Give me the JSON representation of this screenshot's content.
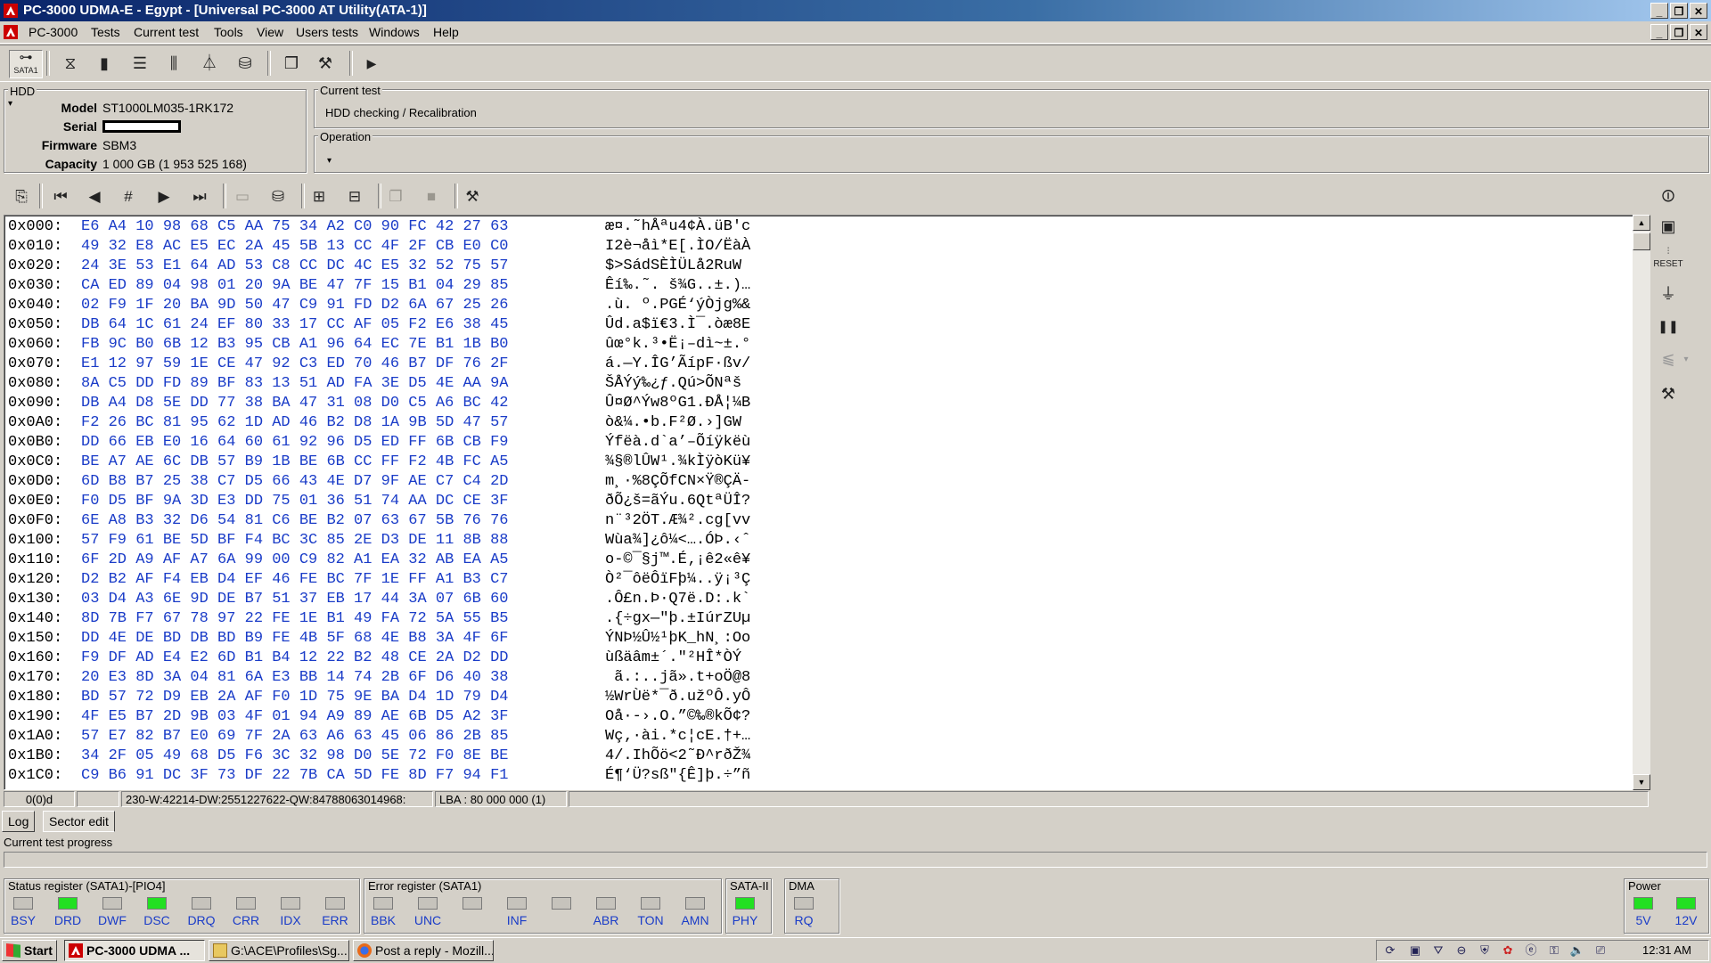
{
  "window": {
    "title": "PC-3000 UDMA-E - Egypt - [Universal PC-3000 AT Utility(ATA-1)]",
    "caption_buttons": [
      "_",
      "❐",
      "✕"
    ],
    "mdi_buttons": [
      "_",
      "❐",
      "✕"
    ]
  },
  "menu": [
    "PC-3000",
    "Tests",
    "Current test",
    "Tools",
    "View",
    "Users tests",
    "Windows",
    "Help"
  ],
  "toolbar": {
    "sata_label": "SATA1",
    "icons": [
      "hdd-icon",
      "chip-icon",
      "list-icon",
      "chart-icon",
      "tree-icon",
      "disk-icon",
      "windows-icon",
      "tools-icon",
      "play-icon"
    ]
  },
  "hdd": {
    "title": "HDD",
    "model_label": "Model",
    "model": "ST1000LM035-1RK172",
    "serial_label": "Serial",
    "firmware_label": "Firmware",
    "firmware": "SBM3",
    "capacity_label": "Capacity",
    "capacity": "1 000 GB (1 953 525 168)"
  },
  "current_test": {
    "title": "Current test",
    "value": "HDD checking / Recalibration"
  },
  "operation": {
    "title": "Operation",
    "value": ""
  },
  "hex_rows": [
    {
      "addr": "0x000:",
      "bytes": "E6 A4 10 98 68 C5 AA 75 34 A2 C0 90 FC 42 27 63",
      "ascii": "æ¤.˜hÅªu4¢À.üB'c"
    },
    {
      "addr": "0x010:",
      "bytes": "49 32 E8 AC E5 EC 2A 45 5B 13 CC 4F 2F CB E0 C0",
      "ascii": "I2è¬åì*E[.ÌO/ËàÀ"
    },
    {
      "addr": "0x020:",
      "bytes": "24 3E 53 E1 64 AD 53 C8 CC DC 4C E5 32 52 75 57",
      "ascii": "$>SádSÈÌÜLå2RuW"
    },
    {
      "addr": "0x030:",
      "bytes": "CA ED 89 04 98 01 20 9A BE 47 7F 15 B1 04 29 85",
      "ascii": "Êí‰.˜. š¾G..±.)…"
    },
    {
      "addr": "0x040:",
      "bytes": "02 F9 1F 20 BA 9D 50 47 C9 91 FD D2 6A 67 25 26",
      "ascii": ".ù. º.PGÉ‘ýÒjg%&"
    },
    {
      "addr": "0x050:",
      "bytes": "DB 64 1C 61 24 EF 80 33 17 CC AF 05 F2 E6 38 45",
      "ascii": "Ûd.a$ï€3.Ì¯.òæ8E"
    },
    {
      "addr": "0x060:",
      "bytes": "FB 9C B0 6B 12 B3 95 CB A1 96 64 EC 7E B1 1B B0",
      "ascii": "ûœ°k.³•Ë¡–dì~±.°"
    },
    {
      "addr": "0x070:",
      "bytes": "E1 12 97 59 1E CE 47 92 C3 ED 70 46 B7 DF 76 2F",
      "ascii": "á.—Y.ÎG’ÃípF·ßv/"
    },
    {
      "addr": "0x080:",
      "bytes": "8A C5 DD FD 89 BF 83 13 51 AD FA 3E D5 4E AA 9A",
      "ascii": "ŠÅÝý‰¿ƒ.Qú>ÕNªš"
    },
    {
      "addr": "0x090:",
      "bytes": "DB A4 D8 5E DD 77 38 BA 47 31 08 D0 C5 A6 BC 42",
      "ascii": "Û¤Ø^Ýw8ºG1.ÐÅ¦¼B"
    },
    {
      "addr": "0x0A0:",
      "bytes": "F2 26 BC 81 95 62 1D AD 46 B2 D8 1A 9B 5D 47 57",
      "ascii": "ò&¼.•b.F²Ø.›]GW"
    },
    {
      "addr": "0x0B0:",
      "bytes": "DD 66 EB E0 16 64 60 61 92 96 D5 ED FF 6B CB F9",
      "ascii": "Ýfëà.d`a’–Õíÿkëù"
    },
    {
      "addr": "0x0C0:",
      "bytes": "BE A7 AE 6C DB 57 B9 1B BE 6B CC FF F2 4B FC A5",
      "ascii": "¾§®lÛW¹.¾kÌÿòKü¥"
    },
    {
      "addr": "0x0D0:",
      "bytes": "6D B8 B7 25 38 C7 D5 66 43 4E D7 9F AE C7 C4 2D",
      "ascii": "m¸·%8ÇÕfCN×Ÿ®ÇÄ-"
    },
    {
      "addr": "0x0E0:",
      "bytes": "F0 D5 BF 9A 3D E3 DD 75 01 36 51 74 AA DC CE 3F",
      "ascii": "ðÕ¿š=ãÝu.6QtªÜÎ?"
    },
    {
      "addr": "0x0F0:",
      "bytes": "6E A8 B3 32 D6 54 81 C6 BE B2 07 63 67 5B 76 76",
      "ascii": "n¨³2ÖT.Æ¾².cg[vv"
    },
    {
      "addr": "0x100:",
      "bytes": "57 F9 61 BE 5D BF F4 BC 3C 85 2E D3 DE 11 8B 88",
      "ascii": "Wùa¾]¿ô¼<….ÓÞ.‹ˆ"
    },
    {
      "addr": "0x110:",
      "bytes": "6F 2D A9 AF A7 6A 99 00 C9 82 A1 EA 32 AB EA A5",
      "ascii": "o-©¯§j™.É‚¡ê2«ê¥"
    },
    {
      "addr": "0x120:",
      "bytes": "D2 B2 AF F4 EB D4 EF 46 FE BC 7F 1E FF A1 B3 C7",
      "ascii": "Ò²¯ôëÔïFþ¼..ÿ¡³Ç"
    },
    {
      "addr": "0x130:",
      "bytes": "03 D4 A3 6E 9D DE B7 51 37 EB 17 44 3A 07 6B 60",
      "ascii": ".Ô£n.Þ·Q7ë.D:.k`"
    },
    {
      "addr": "0x140:",
      "bytes": "8D 7B F7 67 78 97 22 FE 1E B1 49 FA 72 5A 55 B5",
      "ascii": ".{÷gx—\"þ.±IúrZUµ"
    },
    {
      "addr": "0x150:",
      "bytes": "DD 4E DE BD DB BD B9 FE 4B 5F 68 4E B8 3A 4F 6F",
      "ascii": "ÝNÞ½Û½¹þK_hN¸:Oo"
    },
    {
      "addr": "0x160:",
      "bytes": "F9 DF AD E4 E2 6D B1 B4 12 22 B2 48 CE 2A D2 DD",
      "ascii": "ùßäâm±´.\"²HÎ*ÒÝ"
    },
    {
      "addr": "0x170:",
      "bytes": "20 E3 8D 3A 04 81 6A E3 BB 14 74 2B 6F D6 40 38",
      "ascii": " ã.:..jã».t+oÖ@8"
    },
    {
      "addr": "0x180:",
      "bytes": "BD 57 72 D9 EB 2A AF F0 1D 75 9E BA D4 1D 79 D4",
      "ascii": "½WrÙë*¯ð.užºÔ.yÔ"
    },
    {
      "addr": "0x190:",
      "bytes": "4F E5 B7 2D 9B 03 4F 01 94 A9 89 AE 6B D5 A2 3F",
      "ascii": "Oå·-›.O.”©‰®kÕ¢?"
    },
    {
      "addr": "0x1A0:",
      "bytes": "57 E7 82 B7 E0 69 7F 2A 63 A6 63 45 06 86 2B 85",
      "ascii": "Wç‚·ài.*c¦cE.†+…"
    },
    {
      "addr": "0x1B0:",
      "bytes": "34 2F 05 49 68 D5 F6 3C 32 98 D0 5E 72 F0 8E BE",
      "ascii": "4/.IhÕö<2˜Ð^rðŽ¾"
    },
    {
      "addr": "0x1C0:",
      "bytes": "C9 B6 91 DC 3F 73 DF 22 7B CA 5D FE 8D F7 94 F1",
      "ascii": "É¶‘Ü?sß\"{Ê]þ.÷”ñ"
    }
  ],
  "statusline": {
    "pos": "0(0)d",
    "blank": "",
    "info": "230-W:42214-DW:2551227622-QW:84788063014968:",
    "lba": "LBA : 80 000 000 (1)"
  },
  "tabs": [
    "Log",
    "Sector edit"
  ],
  "progress": {
    "label": "Current test progress",
    "value": 0
  },
  "status_register": {
    "title": "Status register (SATA1)-[PIO4]",
    "leds": [
      {
        "name": "BSY",
        "on": false
      },
      {
        "name": "DRD",
        "on": true
      },
      {
        "name": "DWF",
        "on": false
      },
      {
        "name": "DSC",
        "on": true
      },
      {
        "name": "DRQ",
        "on": false
      },
      {
        "name": "CRR",
        "on": false
      },
      {
        "name": "IDX",
        "on": false
      },
      {
        "name": "ERR",
        "on": false
      }
    ]
  },
  "error_register": {
    "title": "Error register (SATA1)",
    "leds": [
      {
        "name": "BBK",
        "on": false
      },
      {
        "name": "UNC",
        "on": false
      },
      {
        "name": "",
        "on": false
      },
      {
        "name": "INF",
        "on": false
      },
      {
        "name": "",
        "on": false
      },
      {
        "name": "ABR",
        "on": false
      },
      {
        "name": "TON",
        "on": false
      },
      {
        "name": "AMN",
        "on": false
      }
    ]
  },
  "sata2": {
    "title": "SATA-II",
    "leds": [
      {
        "name": "PHY",
        "on": true
      }
    ]
  },
  "dma": {
    "title": "DMA",
    "leds": [
      {
        "name": "RQ",
        "on": false
      }
    ]
  },
  "power": {
    "title": "Power",
    "leds": [
      {
        "name": "5V",
        "on": true
      },
      {
        "name": "12V",
        "on": true
      }
    ]
  },
  "led_colors": {
    "on": "#22e022",
    "off": "#c6c3bc"
  },
  "taskbar": {
    "start": "Start",
    "items": [
      {
        "label": "PC-3000 UDMA ...",
        "active": true
      },
      {
        "label": "G:\\ACE\\Profiles\\Sg...",
        "active": false
      },
      {
        "label": "Post a reply - Mozill...",
        "active": false
      }
    ],
    "clock": "12:31 AM"
  }
}
